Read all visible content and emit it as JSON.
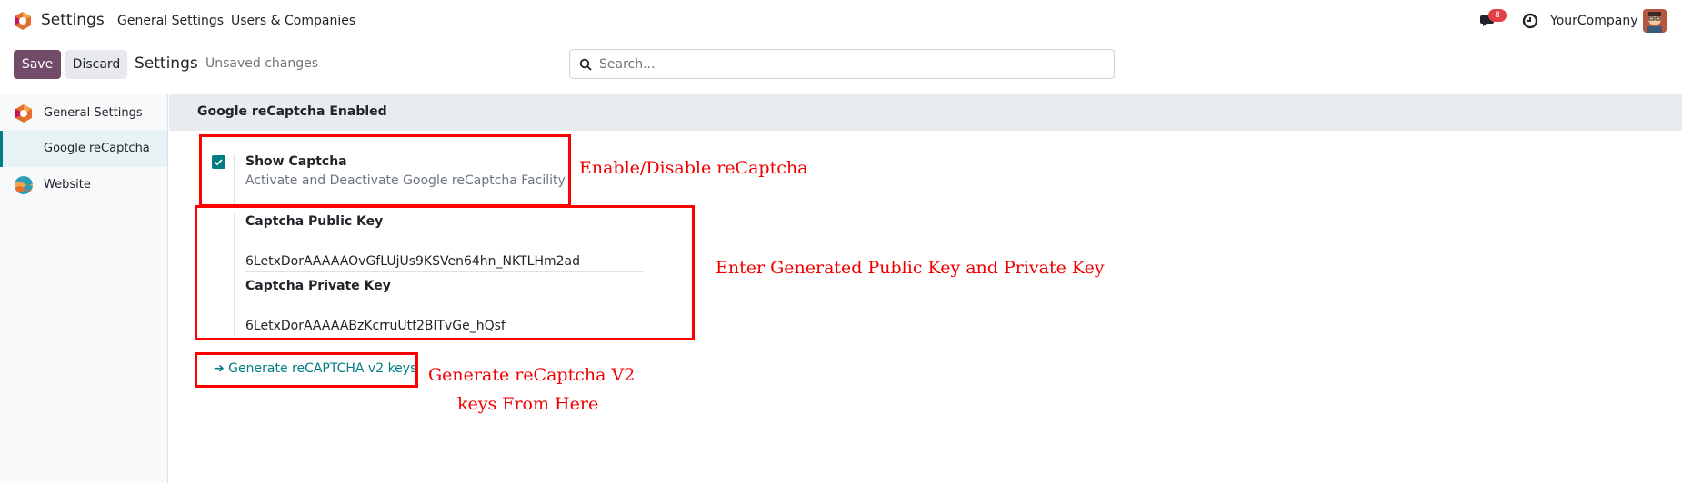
{
  "navbar": {
    "app_name": "Settings",
    "menu": [
      "General Settings",
      "Users & Companies"
    ],
    "message_count": "8",
    "company": "YourCompany",
    "icons": {
      "messages": "chat-icon",
      "activities": "clock-icon",
      "app": "odoo-logo-icon"
    }
  },
  "control_panel": {
    "save_label": "Save",
    "discard_label": "Discard",
    "title": "Settings",
    "status": "Unsaved changes",
    "search_placeholder": "Search..."
  },
  "sidebar": {
    "items": [
      {
        "label": "General Settings",
        "icon": "settings-logo-icon",
        "active": false
      },
      {
        "label": "Google reCaptcha",
        "icon": "",
        "active": true
      },
      {
        "label": "Website",
        "icon": "website-icon",
        "active": false
      }
    ]
  },
  "section": {
    "title": "Google reCaptcha Enabled",
    "show_captcha": {
      "checked": true,
      "label": "Show Captcha",
      "help": "Activate and Deactivate Google reCaptcha Facility"
    },
    "public_key": {
      "label": "Captcha Public Key",
      "value": "6LetxDorAAAAAOvGfLUjUs9KSVen64hn_NKTLHm2ad"
    },
    "private_key": {
      "label": "Captcha Private Key",
      "value": "6LetxDorAAAAABzKcrruUtf2BlTvGe_hQsf"
    },
    "generate_link": "➔ Generate reCAPTCHA v2 keys"
  },
  "annotations": {
    "enable": "Enable/Disable reCaptcha",
    "keys": "Enter Generated Public Key and Private Key",
    "generate_line1": "Generate reCaptcha V2",
    "generate_line2": "keys From Here",
    "color": "#ff0000"
  },
  "colors": {
    "primary": "#714b67",
    "accent": "#017e84",
    "badge": "#e4404a"
  }
}
